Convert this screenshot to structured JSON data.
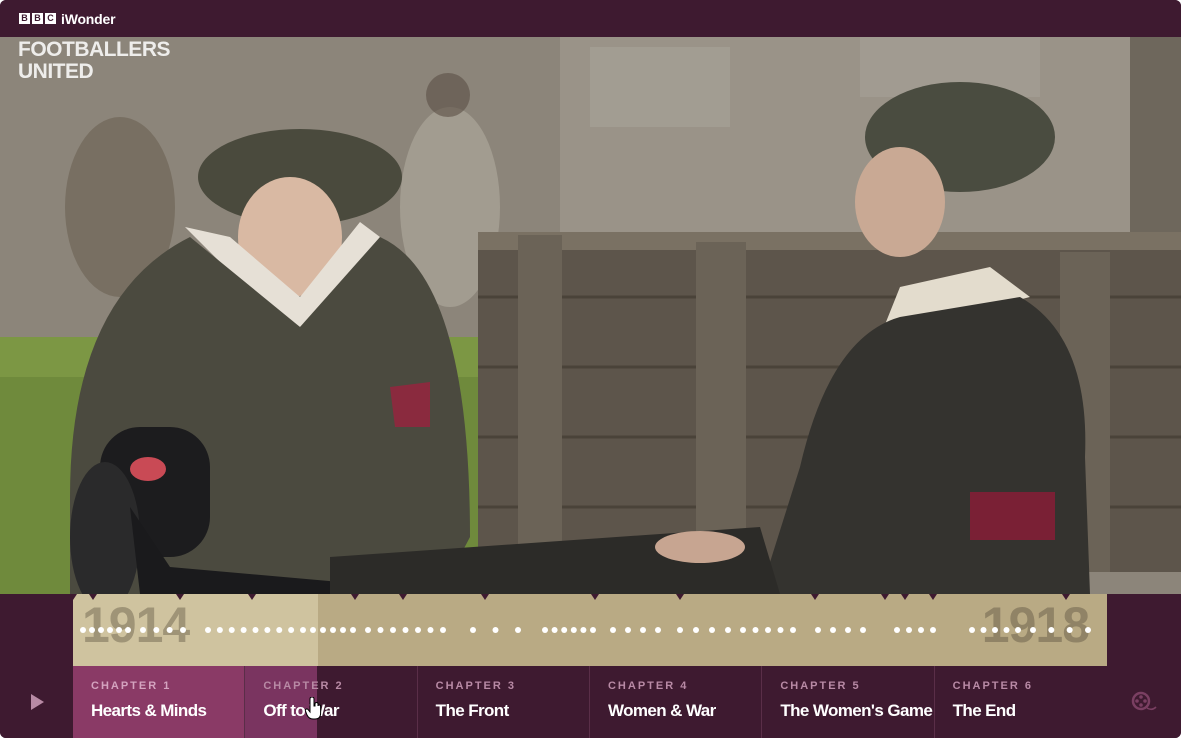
{
  "header": {
    "brand_blocks": [
      "B",
      "B",
      "C"
    ],
    "product": "iWonder"
  },
  "hero": {
    "show_logo_line1": "FOOTBALLERS",
    "show_logo_line2": "UNITED"
  },
  "timeline": {
    "start_year": "1914",
    "end_year": "1918",
    "progress": 0.237
  },
  "chapters": [
    {
      "kicker": "CHAPTER 1",
      "title": "Hearts & Minds",
      "state": "active"
    },
    {
      "kicker": "CHAPTER 2",
      "title": "Off to War",
      "state": "hover"
    },
    {
      "kicker": "CHAPTER 3",
      "title": "The Front",
      "state": "default"
    },
    {
      "kicker": "CHAPTER 4",
      "title": "Women & War",
      "state": "default"
    },
    {
      "kicker": "CHAPTER 5",
      "title": "The Women's Game",
      "state": "default"
    },
    {
      "kicker": "CHAPTER 6",
      "title": "The End",
      "state": "default"
    }
  ],
  "controls": {
    "play_icon": "play-icon",
    "film_icon": "film-reel-icon"
  },
  "colors": {
    "brand_purple": "#3e1a30",
    "active_chapter": "#8a3a66",
    "timeline": "#b9aa84"
  }
}
